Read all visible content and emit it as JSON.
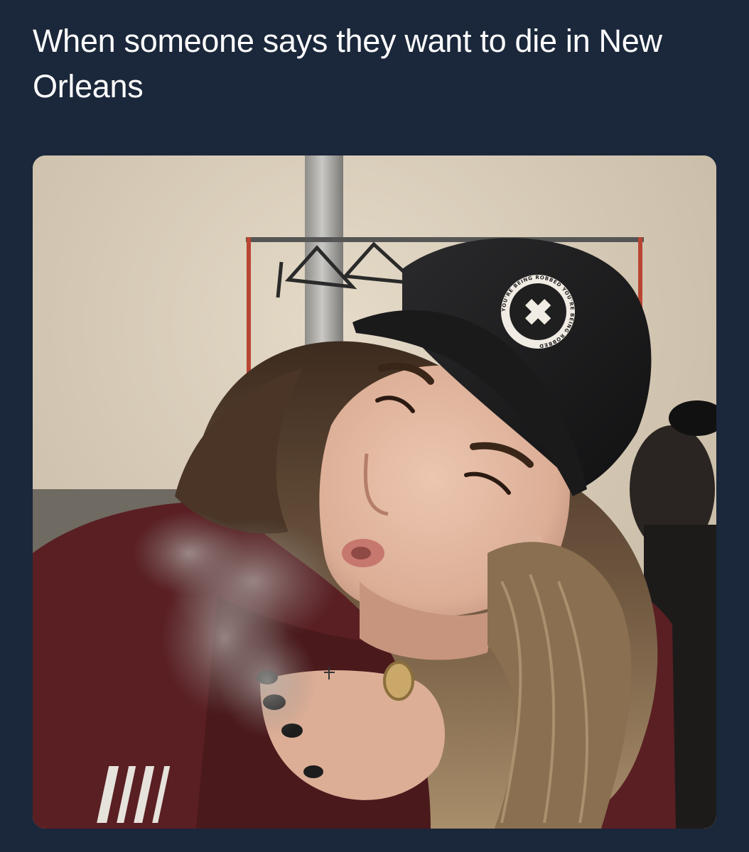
{
  "meme": {
    "caption": "When someone says they want to die in New Orleans"
  },
  "photo": {
    "cap_patch": {
      "text": "YOU'RE BEING ROBBED YOU'RE BEING ROBBED"
    }
  },
  "colors": {
    "background": "#1b273a",
    "caption_text": "#ffffff",
    "wall": "#d9cdb9",
    "cap": "#1f1f20",
    "shirt": "#5a1f23",
    "hair": "#6b5440",
    "skin": "#e2b8a2"
  }
}
